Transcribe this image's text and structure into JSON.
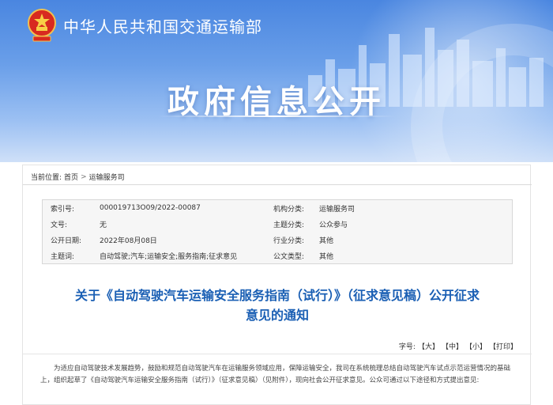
{
  "header": {
    "ministry_name": "中华人民共和国交通运输部",
    "section_title": "政府信息公开"
  },
  "breadcrumb": {
    "label": "当前位置:",
    "items": [
      "首页",
      "运输服务司"
    ],
    "separator": ">"
  },
  "meta": {
    "rows": [
      {
        "label": "索引号:",
        "value": "000019713O09/2022-00087",
        "label2": "机构分类:",
        "value2": "运输服务司"
      },
      {
        "label": "文号:",
        "value": "无",
        "label2": "主题分类:",
        "value2": "公众参与"
      },
      {
        "label": "公开日期:",
        "value": "2022年08月08日",
        "label2": "行业分类:",
        "value2": "其他"
      },
      {
        "label": "主题词:",
        "value": "自动驾驶;汽车;运输安全;服务指南;征求意见",
        "label2": "公文类型:",
        "value2": "其他"
      }
    ]
  },
  "document": {
    "title_line1": "关于《自动驾驶汽车运输安全服务指南（试行）》（征求意见稿）公开征求",
    "title_line2": "意见的通知"
  },
  "font_size": {
    "label": "字号:",
    "large": "【大】",
    "medium": "【中】",
    "small": "【小】",
    "print": "【打印】"
  },
  "body": {
    "paragraph": "为适应自动驾驶技术发展趋势，鼓励和规范自动驾驶汽车在运输服务领域应用，保障运输安全，我司在系统梳理总结自动驾驶汽车试点示范运营情况的基础上，组织起草了《自动驾驶汽车运输安全服务指南（试行）》（征求意见稿）（见附件），现向社会公开征求意见。公众可通过以下途径和方式提出意见:"
  },
  "colors": {
    "banner_top": "#4a86e0",
    "title_blue": "#1a5fb4"
  }
}
